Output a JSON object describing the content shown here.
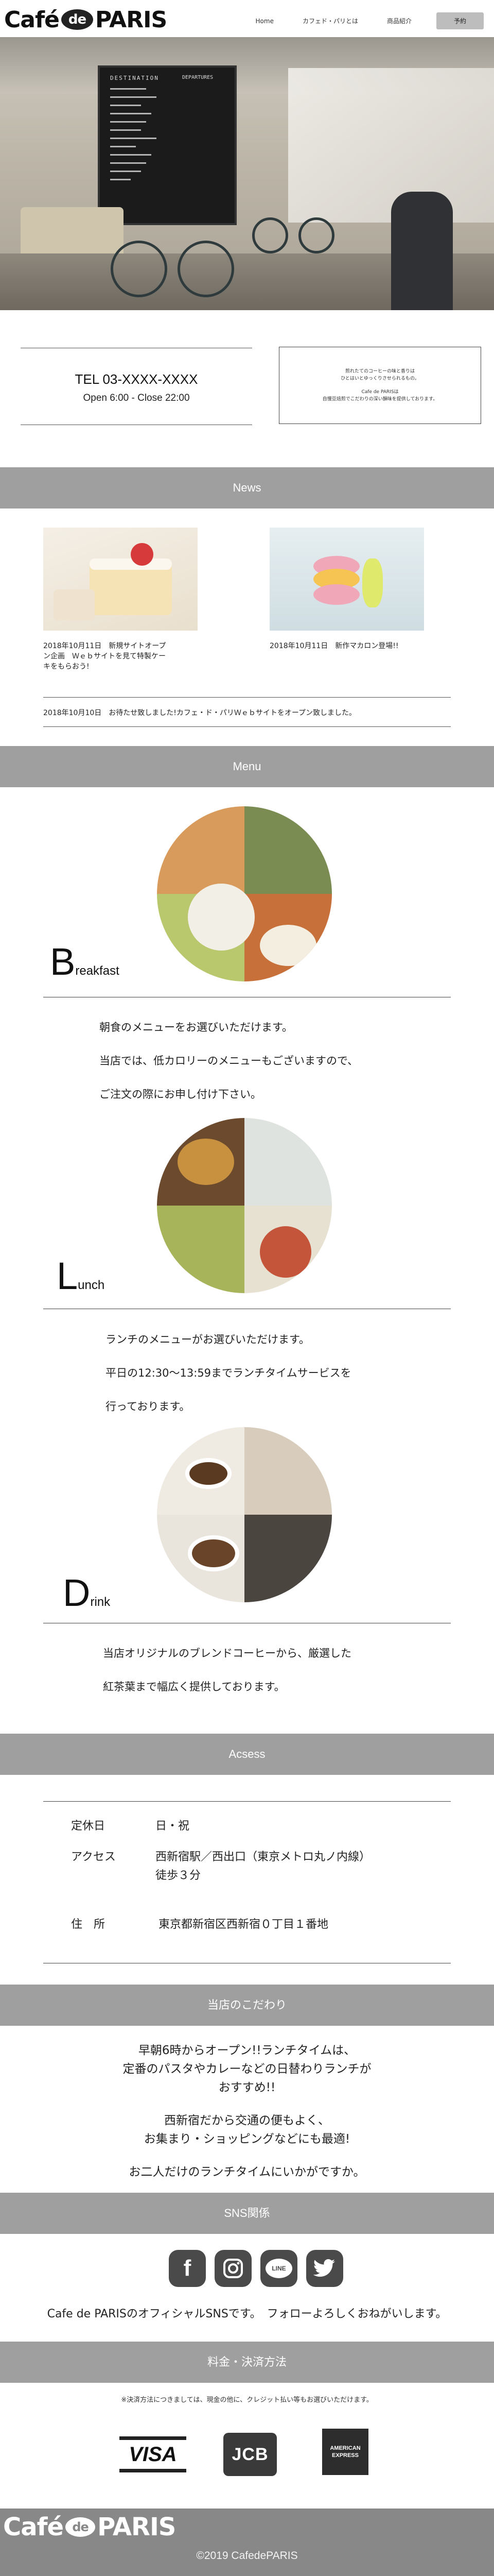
{
  "header": {
    "logo_cafe": "Café",
    "logo_de": "de",
    "logo_paris": "PARIS",
    "nav": [
      "Home",
      "カフェド・パリとは",
      "商品紹介"
    ],
    "reserve_label": "予約"
  },
  "hero": {
    "board_title": "DESTINATION",
    "board_subtitle": "DEPARTURES"
  },
  "contact": {
    "tel": "TEL 03-XXXX-XXXX",
    "hours": "Open 6:00 - Close 22:00"
  },
  "info_box": {
    "line1": "煎れたてのコーヒーの味と香りは",
    "line2": "ひとはいとゆっくりさせられるもの。",
    "line3": "Cafe de PARISは",
    "line4": "自慢豆焙煎でこだわりの深い韻味を提供しております。"
  },
  "sections": {
    "news": "News",
    "menu": "Menu",
    "access": "Acsess",
    "commitment": "当店のこだわり",
    "sns": "SNS関係",
    "payment": "料金・決済方法"
  },
  "news": {
    "item1_line1": "2018年10月11日　新規サイトオープ",
    "item1_line2": "ン企画　Ｗｅｂサイトを見て特製ケー",
    "item1_line3": "キをもらおう!",
    "item2": "2018年10月11日　新作マカロン登場!!",
    "ticker": "2018年10月10日　お待たせ致しました!カフェ・ド・パリＷｅｂサイトをオープン致しました。"
  },
  "menu": {
    "breakfast": {
      "initial": "B",
      "rest": "reakfast",
      "line1": "朝食のメニューをお選びいただけます。",
      "line2": "当店では、低カロリーのメニューもございますので、",
      "line3": "ご注文の際にお申し付け下さい。"
    },
    "lunch": {
      "initial": "L",
      "rest": "unch",
      "line1": "ランチのメニューがお選びいただけます。",
      "line2": "平日の12:30〜13:59までランチタイムサービスを",
      "line3": "行っております。"
    },
    "drink": {
      "initial": "D",
      "rest": "rink",
      "line1": "当店オリジナルのブレンドコーヒーから、厳選した",
      "line2": "紅茶葉まで幅広く提供しております。"
    }
  },
  "access": {
    "holiday_label": "定休日",
    "holiday_value": "日・祝",
    "access_label": "アクセス",
    "access_value1": "西新宿駅／西出口（東京メトロ丸ノ内線）",
    "access_value2": "徒歩３分",
    "address_label": "住　所",
    "address_value": "東京都新宿区西新宿０丁目１番地"
  },
  "commitment": {
    "line1": "早朝6時からオープン!!ランチタイムは、",
    "line2": "定番のパスタやカレーなどの日替わりランチが",
    "line3": "おすすめ!!",
    "line4": "西新宿だから交通の便もよく、",
    "line5": "お集まり・ショッピングなどにも最適!",
    "line6": "お二人だけのランチタイムにいかがですか。"
  },
  "sns": {
    "icons": [
      "facebook-icon",
      "instagram-icon",
      "line-icon",
      "twitter-icon"
    ],
    "facebook_glyph": "f",
    "line_glyph": "LINE",
    "text": "Cafe de PARISのオフィシャルSNSです。　フォローよろしくおねがいします。"
  },
  "payment": {
    "note": "※決済方法につきましては、現金の他に、クレジット払い等もお選びいただけます。",
    "visa": "VISA",
    "jcb": "JCB",
    "amex": "AMERICAN EXPRESS"
  },
  "footer": {
    "logo_cafe": "Café",
    "logo_de": "de",
    "logo_paris": "PARIS",
    "copyright": "©2019 CafedePARIS"
  },
  "colors": {
    "section_bar": "#9f9f9f",
    "footer": "#888888",
    "sns_icon": "#4a4a4a"
  }
}
